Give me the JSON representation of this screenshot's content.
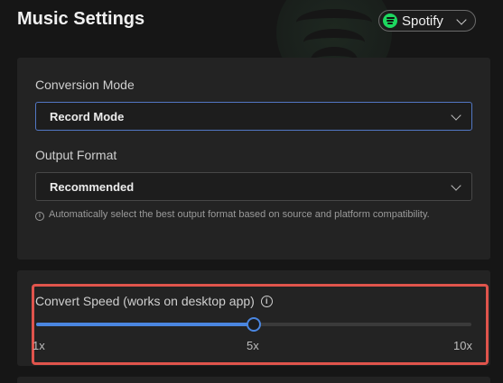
{
  "page": {
    "title": "Music Settings"
  },
  "platform": {
    "name": "Spotify",
    "icon": "spotify-icon"
  },
  "conversion_mode": {
    "label": "Conversion Mode",
    "value": "Record Mode"
  },
  "output_format": {
    "label": "Output Format",
    "value": "Recommended",
    "hint": "Automatically select the best output format based on source and platform compatibility."
  },
  "convert_speed": {
    "label": "Convert Speed (works on desktop app)",
    "min_label": "1x",
    "mid_label": "5x",
    "max_label": "10x",
    "value_fraction": 0.5
  },
  "colors": {
    "accent": "#4a86e0",
    "highlight": "#e0544c",
    "spotify": "#1ed760"
  }
}
